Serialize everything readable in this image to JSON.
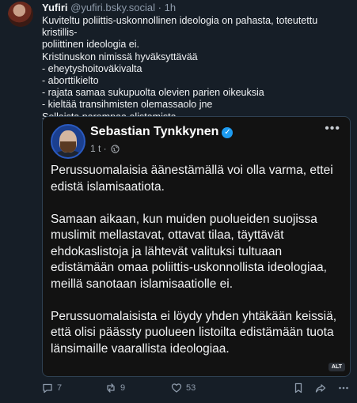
{
  "post": {
    "author_name": "Yufiri",
    "author_handle": "@yufiri.bsky.social",
    "separator": "·",
    "time": "1h",
    "text_lines": [
      "Kuviteltu poliittis-uskonnollinen ideologia on pahasta, toteutettu kristillis-",
      "poliittinen ideologia ei.",
      "Kristinuskon nimissä hyväksyttävää",
      "- eheytyshoitoväkivalta",
      "- aborttikielto",
      "- rajata samaa sukupuolta olevien parien oikeuksia",
      "- kieltää transihmisten olemassaolo jne",
      "Sellaista parempaa alistamista"
    ],
    "embed": {
      "author_name": "Sebastian Tynkkynen",
      "verified_icon": "verified-check-icon",
      "time": "1 t ·",
      "paragraphs": [
        "Perussuomalaisia äänestämällä voi olla varma, ettei edistä islamisaatiota.",
        "Samaan aikaan, kun muiden puolueiden suojissa muslimit mellastavat, ottavat tilaa, täyttävät ehdokaslistoja ja lähtevät valituksi tultuaan edistämään omaa poliittis-uskonnollista ideologiaa, meillä sanotaan islamisaatiolle ei.",
        "Perussuomalaisista ei löydy yhden yhtäkään keissiä, että olisi päässty puolueen listoilta edistämään tuota länsimaille vaarallista ideologiaa."
      ],
      "more_label": "•••",
      "alt_badge": "ALT"
    },
    "actions": {
      "replies": "7",
      "reposts": "9",
      "likes": "53"
    },
    "colors": {
      "background": "#161e27",
      "embed_background": "#121212",
      "muted_text": "#8e9bab",
      "verified": "#1d9bf0"
    }
  }
}
